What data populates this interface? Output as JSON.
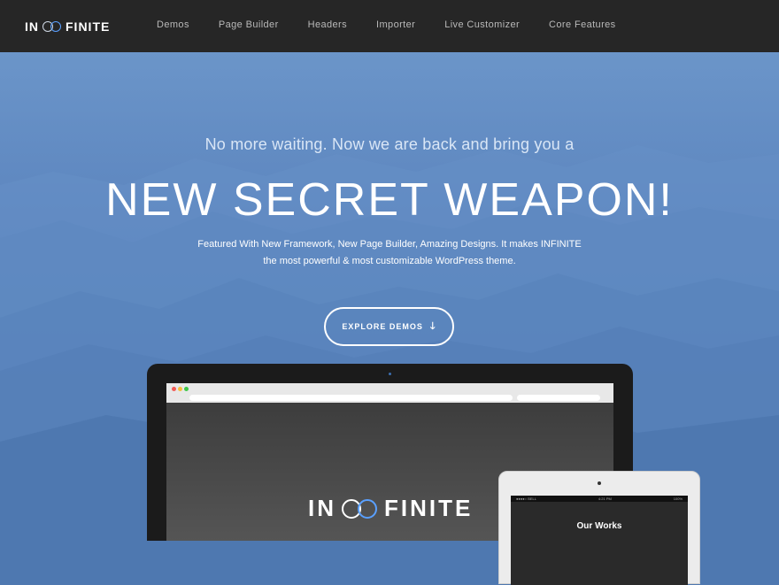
{
  "nav": {
    "logo_left": "IN",
    "logo_right": "FINITE",
    "items": [
      "Demos",
      "Page Builder",
      "Headers",
      "Importer",
      "Live Customizer",
      "Core Features"
    ]
  },
  "hero": {
    "subtitle": "No more waiting. Now we are back and bring you a",
    "title": "NEW SECRET WEAPON!",
    "description": "Featured With New Framework, New Page Builder, Amazing Designs. It makes INFINITE the most powerful & most customizable WordPress theme.",
    "cta_label": "EXPLORE DEMOS",
    "cta_icon": "arrow-down-icon"
  },
  "mockup": {
    "site_logo_left": "IN",
    "site_logo_right": "FINITE",
    "tablet_status_left": "●●●●○ BELL",
    "tablet_status_center": "4:21 PM",
    "tablet_status_right": "100%",
    "tablet_title": "Our Works"
  },
  "colors": {
    "nav_bg": "#262626",
    "hero_bg": "#5d86bf",
    "accent": "#5aa0ff"
  }
}
